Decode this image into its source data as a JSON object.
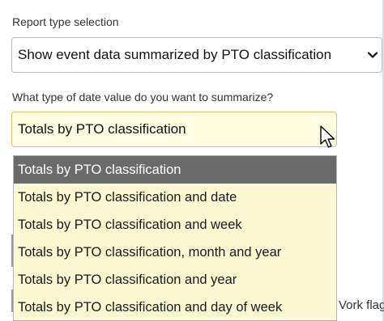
{
  "report_type": {
    "label": "Report type selection",
    "selected": "Show event data summarized by PTO classification"
  },
  "date_value": {
    "label": "What type of date value do you want to summarize?",
    "selected": "Totals by PTO classification",
    "options": [
      "Totals by PTO classification",
      "Totals by PTO classification and date",
      "Totals by PTO classification and week",
      "Totals by PTO classification, month and year",
      "Totals by PTO classification and year",
      "Totals by PTO classification and day of week"
    ],
    "highlighted_index": 0
  },
  "background": {
    "partial_text": "Vork flag"
  },
  "colors": {
    "dropdown_bg": "#fbf8d2",
    "highlight_bg": "#6b6b6b",
    "focused_border": "#e0c070"
  },
  "icons": [
    "chevron-down-icon",
    "mouse-cursor-icon"
  ]
}
